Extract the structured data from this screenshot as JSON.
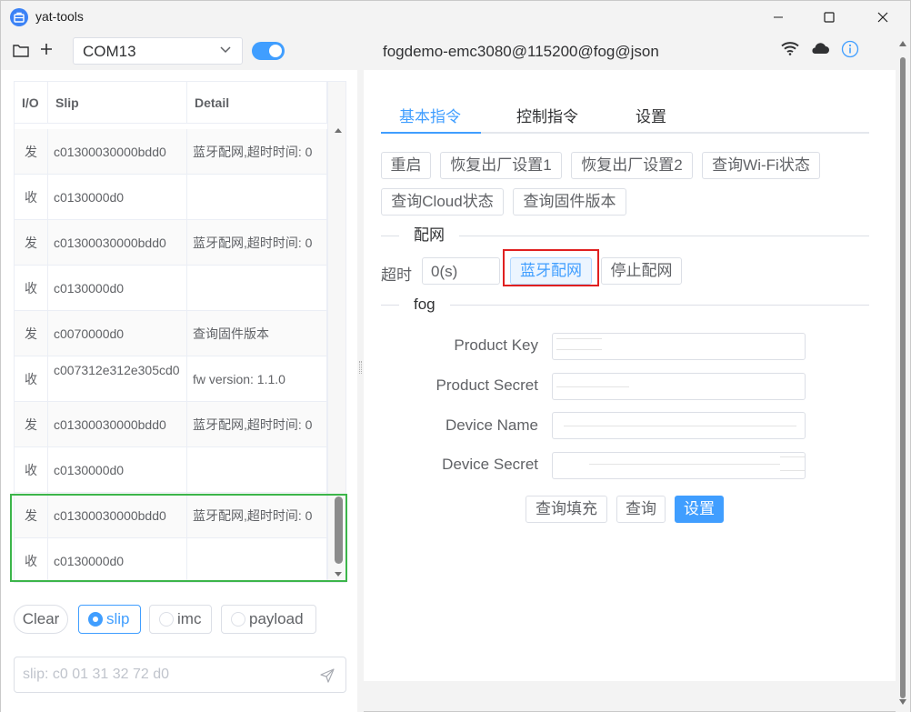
{
  "window": {
    "title": "yat-tools"
  },
  "toolbar": {
    "port": "COM13",
    "connection": "fogdemo-emc3080@115200@fog@json",
    "connected": true
  },
  "log": {
    "headers": {
      "io": "I/O",
      "slip": "Slip",
      "detail": "Detail"
    },
    "rows": [
      {
        "io": "发",
        "slip": "c01300030000bdd0",
        "detail": "蓝牙配网,超时时间: 0"
      },
      {
        "io": "收",
        "slip": "c0130000d0",
        "detail": ""
      },
      {
        "io": "发",
        "slip": "c01300030000bdd0",
        "detail": "蓝牙配网,超时时间: 0"
      },
      {
        "io": "收",
        "slip": "c0130000d0",
        "detail": ""
      },
      {
        "io": "发",
        "slip": "c0070000d0",
        "detail": "查询固件版本"
      },
      {
        "io": "收",
        "slip": "c007312e312e305cd0",
        "detail": "fw version: 1.1.0"
      },
      {
        "io": "发",
        "slip": "c01300030000bdd0",
        "detail": "蓝牙配网,超时时间: 0"
      },
      {
        "io": "收",
        "slip": "c0130000d0",
        "detail": ""
      },
      {
        "io": "发",
        "slip": "c01300030000bdd0",
        "detail": "蓝牙配网,超时时间: 0"
      },
      {
        "io": "收",
        "slip": "c0130000d0",
        "detail": ""
      }
    ]
  },
  "filters": {
    "clear": "Clear",
    "options": [
      "slip",
      "imc",
      "payload"
    ],
    "selected": "slip"
  },
  "send": {
    "placeholder": "slip: c0 01 31 32 72 d0"
  },
  "tabs": [
    "基本指令",
    "控制指令",
    "设置"
  ],
  "basic": {
    "buttons": [
      "重启",
      "恢复出厂设置1",
      "恢复出厂设置2",
      "查询Wi-Fi状态",
      "查询Cloud状态",
      "查询固件版本"
    ]
  },
  "network": {
    "section": "配网",
    "timeout_label": "超时",
    "timeout_value": "0(s)",
    "ble_button": "蓝牙配网",
    "stop_button": "停止配网"
  },
  "fog": {
    "section": "fog",
    "fields": [
      "Product Key",
      "Product Secret",
      "Device Name",
      "Device Secret"
    ],
    "buttons": {
      "query_fill": "查询填充",
      "query": "查询",
      "set": "设置"
    }
  },
  "colors": {
    "primary": "#409eff",
    "highlight_green": "#3cb54a",
    "highlight_red": "#e02020"
  }
}
